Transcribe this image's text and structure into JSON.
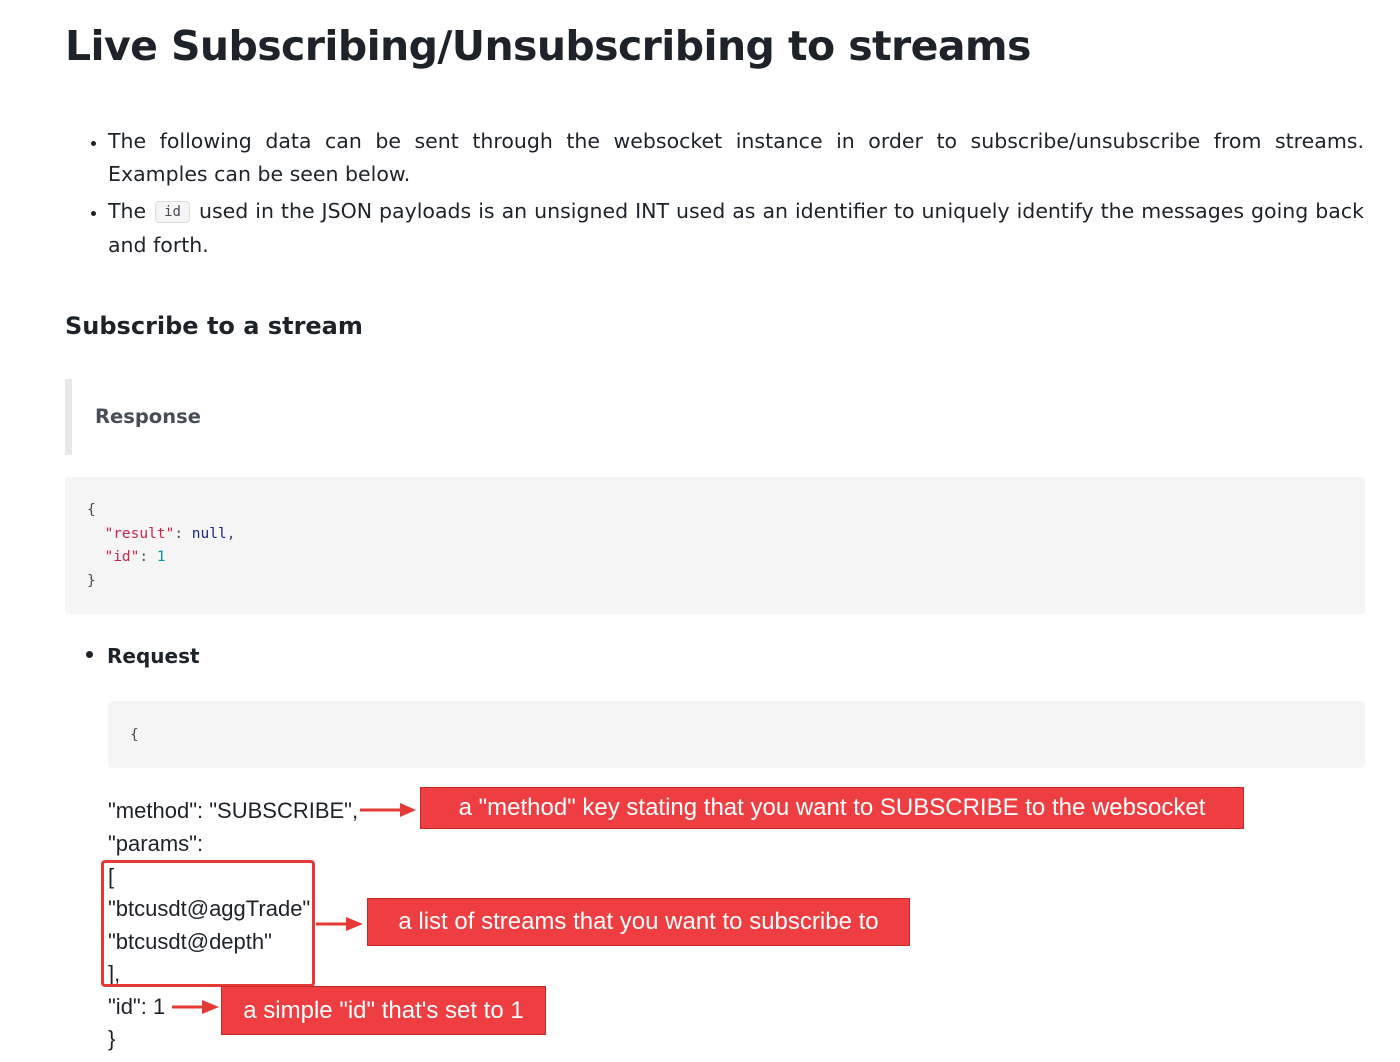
{
  "page_title": "Live Subscribing/Unsubscribing to streams",
  "bullets": {
    "item1": "The following data can be sent through the websocket instance in order to subscribe/unsubscribe from streams. Examples can be seen below.",
    "item2_before": "The",
    "item2_code": "id",
    "item2_after": "used in the JSON payloads is an unsigned INT used as an identifier to uniquely identify the messages going back and forth."
  },
  "section_heading": "Subscribe to a stream",
  "response_label": "Response",
  "response_code": {
    "open": "{",
    "result_key": "\"result\"",
    "result_value": "null",
    "id_key": "\"id\"",
    "id_value": "1",
    "close": "}"
  },
  "request_label": "Request",
  "request_code_open": "{",
  "request_lines": {
    "method": "\"method\": \"SUBSCRIBE\",",
    "params": "\"params\":",
    "bracket_open": "[",
    "stream1": "\"btcusdt@aggTrade\",",
    "stream2": "\"btcusdt@depth\"",
    "bracket_close": "],",
    "id": "\"id\": 1",
    "close": "}"
  },
  "annotations": {
    "method_note": "a \"method\" key stating that you want to SUBSCRIBE to the websocket",
    "streams_note": "a list of streams that you want to subscribe to",
    "id_note": "a simple \"id\" that's set to 1"
  },
  "colors": {
    "callout_bg": "#ef3e42",
    "code_bg": "#f5f5f5",
    "text": "#1e2329"
  }
}
